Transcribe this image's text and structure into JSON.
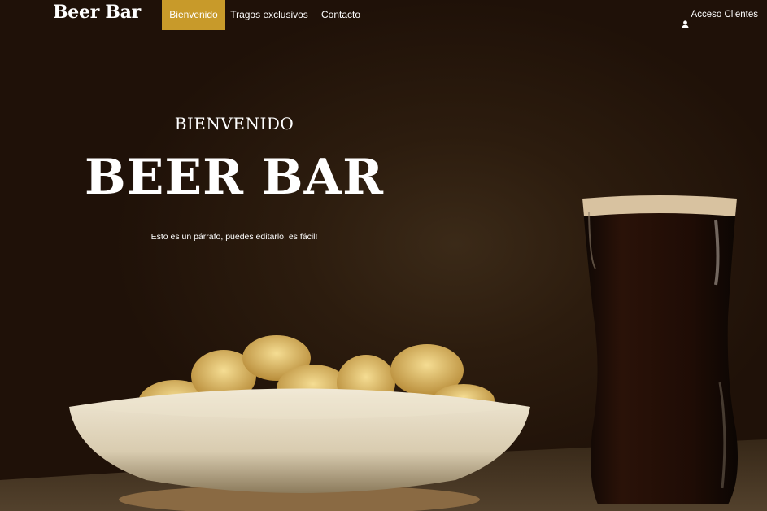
{
  "header": {
    "brand": "Beer Bar",
    "nav": [
      {
        "label": "Bienvenido",
        "active": true
      },
      {
        "label": "Tragos exclusivos",
        "active": false
      },
      {
        "label": "Contacto",
        "active": false
      }
    ],
    "login": {
      "label": "Acceso Clientes",
      "icon": "user-icon"
    }
  },
  "hero": {
    "subtitle": "BIENVENIDO",
    "title": "BEER BAR",
    "paragraph": "Esto es un párrafo, puedes editarlo, es fácil!"
  },
  "colors": {
    "accent": "#c89a2a",
    "background": "#241409",
    "text": "#ffffff"
  }
}
